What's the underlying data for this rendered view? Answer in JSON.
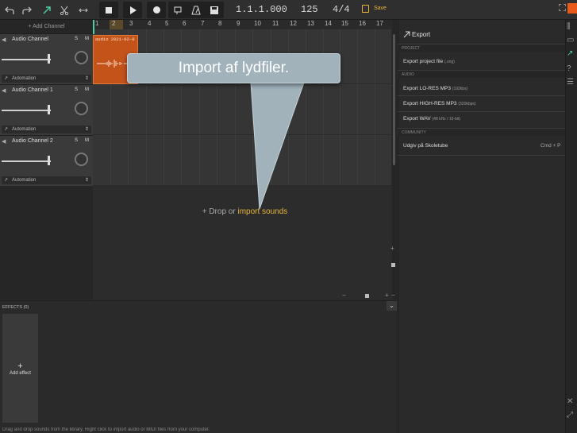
{
  "toolbar": {
    "position": "1.1.1.000",
    "tempo": "125",
    "time_signature": "4/4",
    "save_label": "Save",
    "icons": [
      "undo-icon",
      "redo-icon",
      "pointer-tool-icon",
      "scissors-tool-icon",
      "stretch-tool-icon",
      "stop-icon",
      "play-icon",
      "record-icon",
      "loop-icon",
      "metronome-icon",
      "keyboard-icon",
      "save-icon"
    ]
  },
  "tracks": {
    "add_channel_label": "+ Add Channel",
    "items": [
      {
        "name": "Audio Channel",
        "solo": "S",
        "mute": "M",
        "automation": "Automation"
      },
      {
        "name": "Audio Channel 1",
        "solo": "S",
        "mute": "M",
        "automation": "Automation"
      },
      {
        "name": "Audio Channel 2",
        "solo": "S",
        "mute": "M",
        "automation": "Automation"
      }
    ]
  },
  "ruler": {
    "bars": [
      "1",
      "2",
      "3",
      "4",
      "5",
      "6",
      "7",
      "8",
      "9",
      "10",
      "11",
      "12",
      "13",
      "14",
      "15",
      "16",
      "17"
    ]
  },
  "clip": {
    "label": "audio 2021-02-0",
    "color": "#c4531a"
  },
  "drop": {
    "prefix": "+ Drop or ",
    "link": "import sounds"
  },
  "callout": {
    "text": "Import af lydfiler."
  },
  "export_panel": {
    "title": "Export",
    "sections": [
      {
        "name": "PROJECT",
        "items": [
          {
            "label": "Export project file",
            "detail": "(.sng)",
            "shortcut": ""
          }
        ]
      },
      {
        "name": "AUDIO",
        "items": [
          {
            "label": "Export LO-RES MP3",
            "detail": "(192kbs)",
            "shortcut": ""
          },
          {
            "label": "Export HIGH-RES MP3",
            "detail": "(320kbps)",
            "shortcut": ""
          },
          {
            "label": "Export WAV",
            "detail": "(48 kHz / 16-bit)",
            "shortcut": ""
          }
        ]
      },
      {
        "name": "COMMUNITY",
        "items": [
          {
            "label": "Udgiv på Skoletube",
            "detail": "",
            "shortcut": "Cmd + P"
          }
        ]
      }
    ]
  },
  "effects": {
    "label": "EFFECTS (0)",
    "add_label": "Add effect",
    "plus": "+"
  },
  "status_text": "Drag and drop sounds from the library. Right click to import audio or MIDI files from your computer.",
  "colors": {
    "accent": "#e8b53a",
    "clip": "#c4531a",
    "highlight": "#4fd0a0"
  }
}
